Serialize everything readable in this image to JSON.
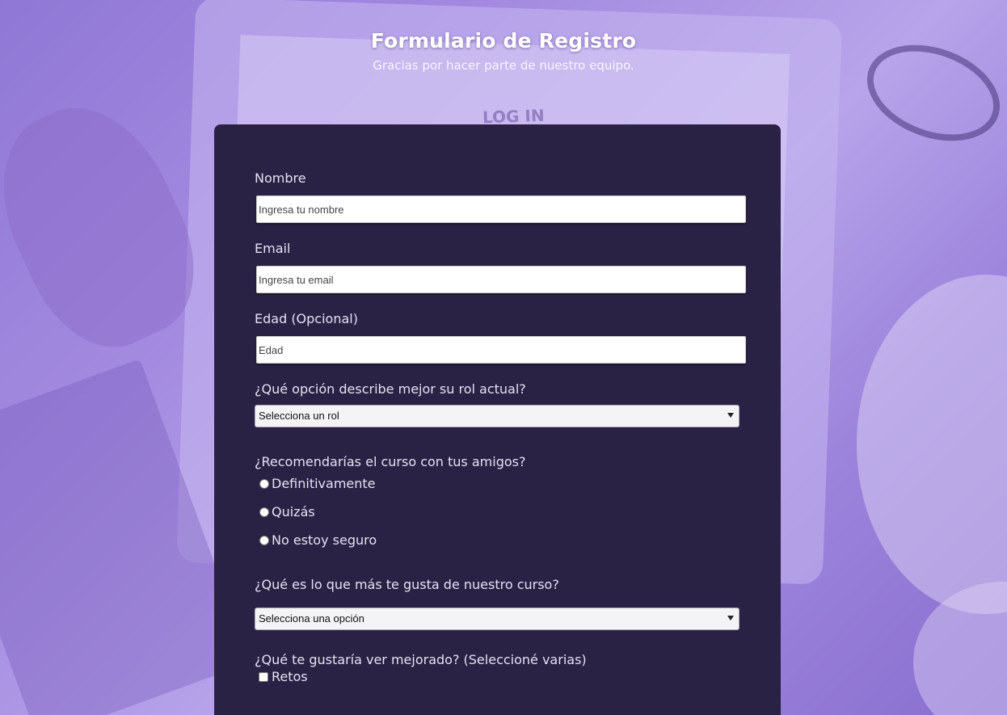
{
  "header": {
    "title": "Formulario de Registro",
    "subtitle": "Gracias por hacer parte de nuestro equipo."
  },
  "background": {
    "screen_text": "LOG IN"
  },
  "form": {
    "name": {
      "label": "Nombre",
      "placeholder": "Ingresa tu nombre"
    },
    "email": {
      "label": "Email",
      "placeholder": "Ingresa tu email"
    },
    "age": {
      "label": "Edad (Opcional)",
      "placeholder": "Edad"
    },
    "role": {
      "label": "¿Qué opción describe mejor su rol actual?",
      "selected": "Selecciona un rol"
    },
    "recommend": {
      "label": "¿Recomendarías el curso con tus amigos?",
      "options": [
        "Definitivamente",
        "Quizás",
        "No estoy seguro"
      ]
    },
    "favorite": {
      "label": "¿Qué es lo que más te gusta de nuestro curso?",
      "selected": "Selecciona una opción"
    },
    "improve": {
      "label": "¿Qué te gustaría ver mejorado? (Seleccioné varias)",
      "options": [
        "Retos"
      ]
    }
  }
}
